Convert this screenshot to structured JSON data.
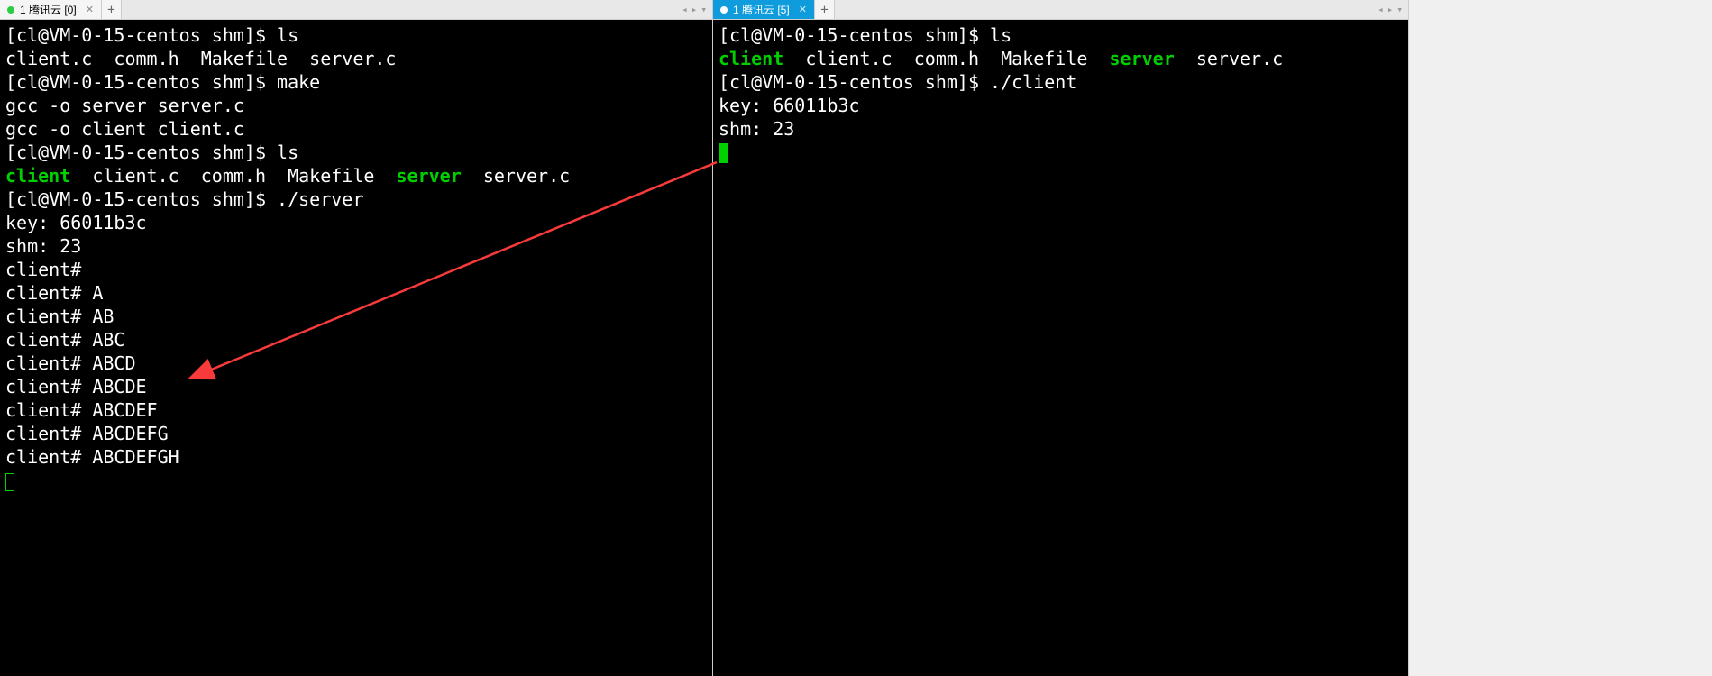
{
  "leftPane": {
    "tab": {
      "label": "1 腾讯云 [0]"
    },
    "terminal": {
      "prompt": "[cl@VM-0-15-centos shm]$ ",
      "cmd_ls1": "ls",
      "ls1_out": "client.c  comm.h  Makefile  server.c",
      "cmd_make": "make",
      "make_out1": "gcc -o server server.c",
      "make_out2": "gcc -o client client.c",
      "cmd_ls2": "ls",
      "ls2_client": "client",
      "ls2_mid": "  client.c  comm.h  Makefile  ",
      "ls2_server": "server",
      "ls2_tail": "  server.c",
      "cmd_server": "./server",
      "key": "key: 66011b3c",
      "shm": "shm: 23",
      "c0": "client#",
      "c1": "client# A",
      "c2": "client# AB",
      "c3": "client# ABC",
      "c4": "client# ABCD",
      "c5": "client# ABCDE",
      "c6": "client# ABCDEF",
      "c7": "client# ABCDEFG",
      "c8": "client# ABCDEFGH"
    }
  },
  "rightPane": {
    "tab": {
      "label": "1 腾讯云 [5]"
    },
    "terminal": {
      "prompt": "[cl@VM-0-15-centos shm]$ ",
      "cmd_ls": "ls",
      "ls_client": "client",
      "ls_mid": "  client.c  comm.h  Makefile  ",
      "ls_server": "server",
      "ls_tail": "  server.c",
      "cmd_client": "./client",
      "key": "key: 66011b3c",
      "shm": "shm: 23"
    }
  }
}
